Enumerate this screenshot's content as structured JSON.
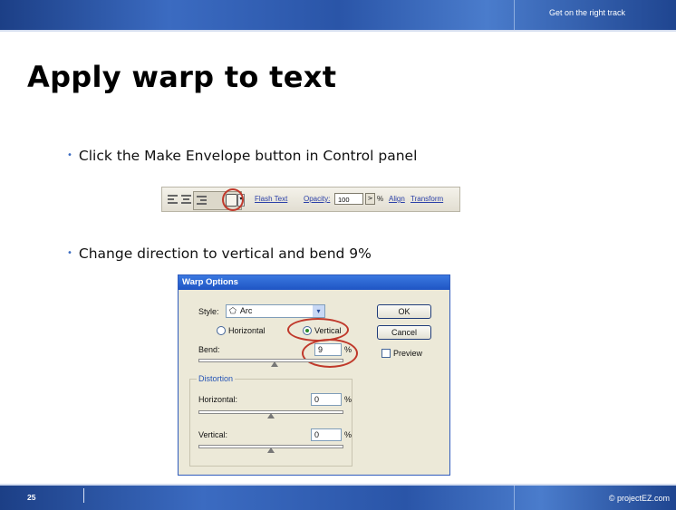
{
  "header": {
    "tagline": "Get on the right track"
  },
  "slide": {
    "title": "Apply warp to text",
    "bullets": [
      "Click the Make Envelope button in Control panel",
      "Change direction to vertical and bend 9%"
    ]
  },
  "control_panel": {
    "flash_text_label": "Flash Text",
    "opacity_label": "Opacity:",
    "opacity_value": "100",
    "opacity_unit": "%",
    "align_label": "Align",
    "transform_label": "Transform",
    "arrow_glyph": ">"
  },
  "warp_dialog": {
    "title": "Warp Options",
    "style_label": "Style:",
    "style_value": "Arc",
    "horizontal_label": "Horizontal",
    "vertical_label": "Vertical",
    "direction_selected": "Vertical",
    "bend_label": "Bend:",
    "bend_value": "9",
    "bend_unit": "%",
    "ok_label": "OK",
    "cancel_label": "Cancel",
    "preview_label": "Preview",
    "preview_checked": false,
    "distortion_label": "Distortion",
    "dist_horizontal_label": "Horizontal:",
    "dist_horizontal_value": "0",
    "dist_horizontal_unit": "%",
    "dist_vertical_label": "Vertical:",
    "dist_vertical_value": "0",
    "dist_vertical_unit": "%"
  },
  "footer": {
    "page_number": "25",
    "copyright": "© projectEZ.com"
  },
  "colors": {
    "banner": "#2a55a8",
    "highlight": "#c0392b",
    "dialog_bg": "#ece9d8"
  }
}
